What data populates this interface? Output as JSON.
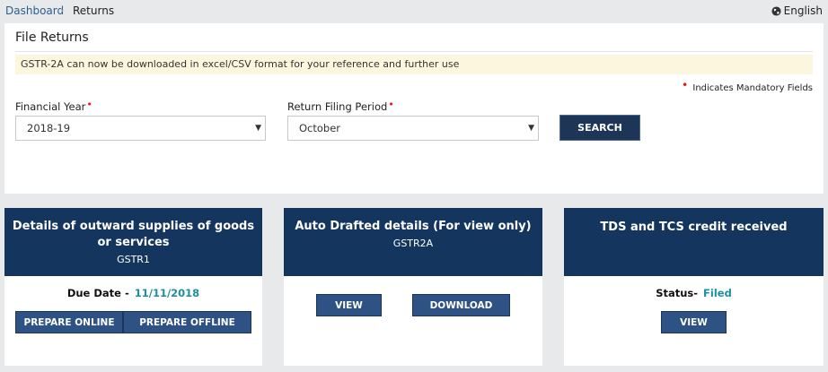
{
  "breadcrumb": {
    "home": "Dashboard",
    "separator": "›",
    "current": "Returns"
  },
  "language": {
    "label": "English"
  },
  "panel": {
    "title": "File Returns",
    "notice": "GSTR-2A can now be downloaded in excel/CSV format for your reference and further use",
    "mandatory_marker": "•",
    "mandatory_text": "Indicates Mandatory Fields",
    "financial_year": {
      "label": "Financial Year",
      "value": "2018-19"
    },
    "return_period": {
      "label": "Return Filing Period",
      "value": "October"
    },
    "search_label": "SEARCH"
  },
  "cards": {
    "outward": {
      "title": "Details of outward supplies of goods or services",
      "subtitle": "GSTR1",
      "due_label": "Due Date -",
      "due_value": "11/11/2018",
      "prepare_online": "PREPARE ONLINE",
      "prepare_offline": "PREPARE OFFLINE"
    },
    "auto": {
      "title": "Auto Drafted details (For view only)",
      "subtitle": "GSTR2A",
      "view": "VIEW",
      "download": "DOWNLOAD"
    },
    "tds": {
      "title": "TDS and TCS credit received",
      "status_label": "Status-",
      "status_value": "Filed",
      "view": "VIEW"
    }
  },
  "colors": {
    "header_navy": "#14365e",
    "button_blue": "#2d5283",
    "accent_teal": "#1d8fa3",
    "required_red": "#e01919",
    "notice_bg": "#fdf6df"
  }
}
